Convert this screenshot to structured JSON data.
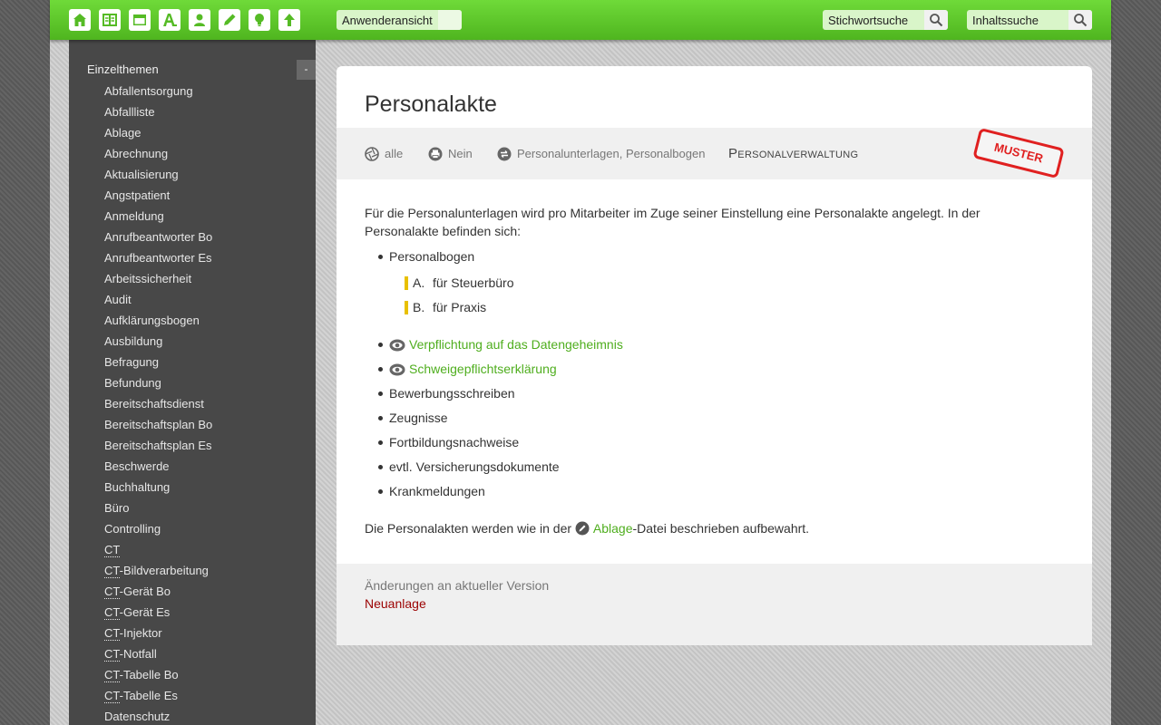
{
  "topbar": {
    "icons": [
      "home-icon",
      "book-icon",
      "folder-icon",
      "font-icon",
      "user-icon",
      "pencil-icon",
      "lightbulb-icon",
      "upload-icon"
    ],
    "view_select": {
      "value": "Anwenderansicht"
    },
    "keyword_search": {
      "value": "Stichwortsuche"
    },
    "content_search": {
      "value": "Inhaltssuche"
    }
  },
  "sidebar": {
    "heading": "Einzelthemen",
    "collapse_label": "-",
    "items": [
      {
        "label": "Abfallentsorgung"
      },
      {
        "label": "Abfallliste"
      },
      {
        "label": "Ablage"
      },
      {
        "label": "Abrechnung"
      },
      {
        "label": "Aktualisierung"
      },
      {
        "label": "Angstpatient"
      },
      {
        "label": "Anmeldung"
      },
      {
        "label": "Anrufbeantworter Bo"
      },
      {
        "label": "Anrufbeantworter Es"
      },
      {
        "label": "Arbeitssicherheit"
      },
      {
        "label": "Audit"
      },
      {
        "label": "Aufklärungsbogen"
      },
      {
        "label": "Ausbildung"
      },
      {
        "label": "Befragung"
      },
      {
        "label": "Befundung"
      },
      {
        "label": "Bereitschaftsdienst"
      },
      {
        "label": "Bereitschaftsplan Bo"
      },
      {
        "label": "Bereitschaftsplan Es"
      },
      {
        "label": "Beschwerde"
      },
      {
        "label": "Buchhaltung"
      },
      {
        "label": "Büro"
      },
      {
        "label": "Controlling"
      },
      {
        "abbr": "CT",
        "label": ""
      },
      {
        "abbr": "CT",
        "label": "-Bildverarbeitung"
      },
      {
        "abbr": "CT",
        "label": "-Gerät Bo"
      },
      {
        "abbr": "CT",
        "label": "-Gerät Es"
      },
      {
        "abbr": "CT",
        "label": "-Injektor"
      },
      {
        "abbr": "CT",
        "label": "-Notfall"
      },
      {
        "abbr": "CT",
        "label": "-Tabelle Bo"
      },
      {
        "abbr": "CT",
        "label": "-Tabelle Es"
      },
      {
        "label": "Datenschutz"
      }
    ]
  },
  "document": {
    "title": "Personalakte",
    "meta": {
      "audience": "alle",
      "print": "Nein",
      "related": "Personalunterlagen, Personalbogen",
      "department": "Personalverwaltung",
      "stamp": "MUSTER"
    },
    "intro": "Für die Personalunterlagen wird pro Mitarbeiter im Zuge seiner Einstellung eine Personalakte angelegt. In der Personalakte befinden sich:",
    "first_bullet": "Personalbogen",
    "sub_items": [
      {
        "letter": "A.",
        "text": "für Steuerbüro"
      },
      {
        "letter": "B.",
        "text": "für Praxis"
      }
    ],
    "link_bullets": [
      "Verpflichtung auf das Datengeheimnis",
      "Schweigepflichtserklärung"
    ],
    "bullets": [
      "Bewerbungsschreiben",
      "Zeugnisse",
      "Fortbildungsnachweise",
      "evtl. Versicherungsdokumente",
      "Krankmeldungen"
    ],
    "closing": {
      "before": "Die Personalakten werden wie in der ",
      "link": "Ablage",
      "after": "-Datei beschrieben aufbewahrt."
    },
    "footer": {
      "label": "Änderungen an aktueller Version",
      "status": "Neuanlage"
    }
  },
  "colors": {
    "topbar_green": "#5cc82a",
    "link_green": "#4fae1e",
    "sidebar_bg": "#484848",
    "stamp_red": "#e02020",
    "status_red": "#9b0000",
    "marker_yellow": "#e8c000"
  }
}
